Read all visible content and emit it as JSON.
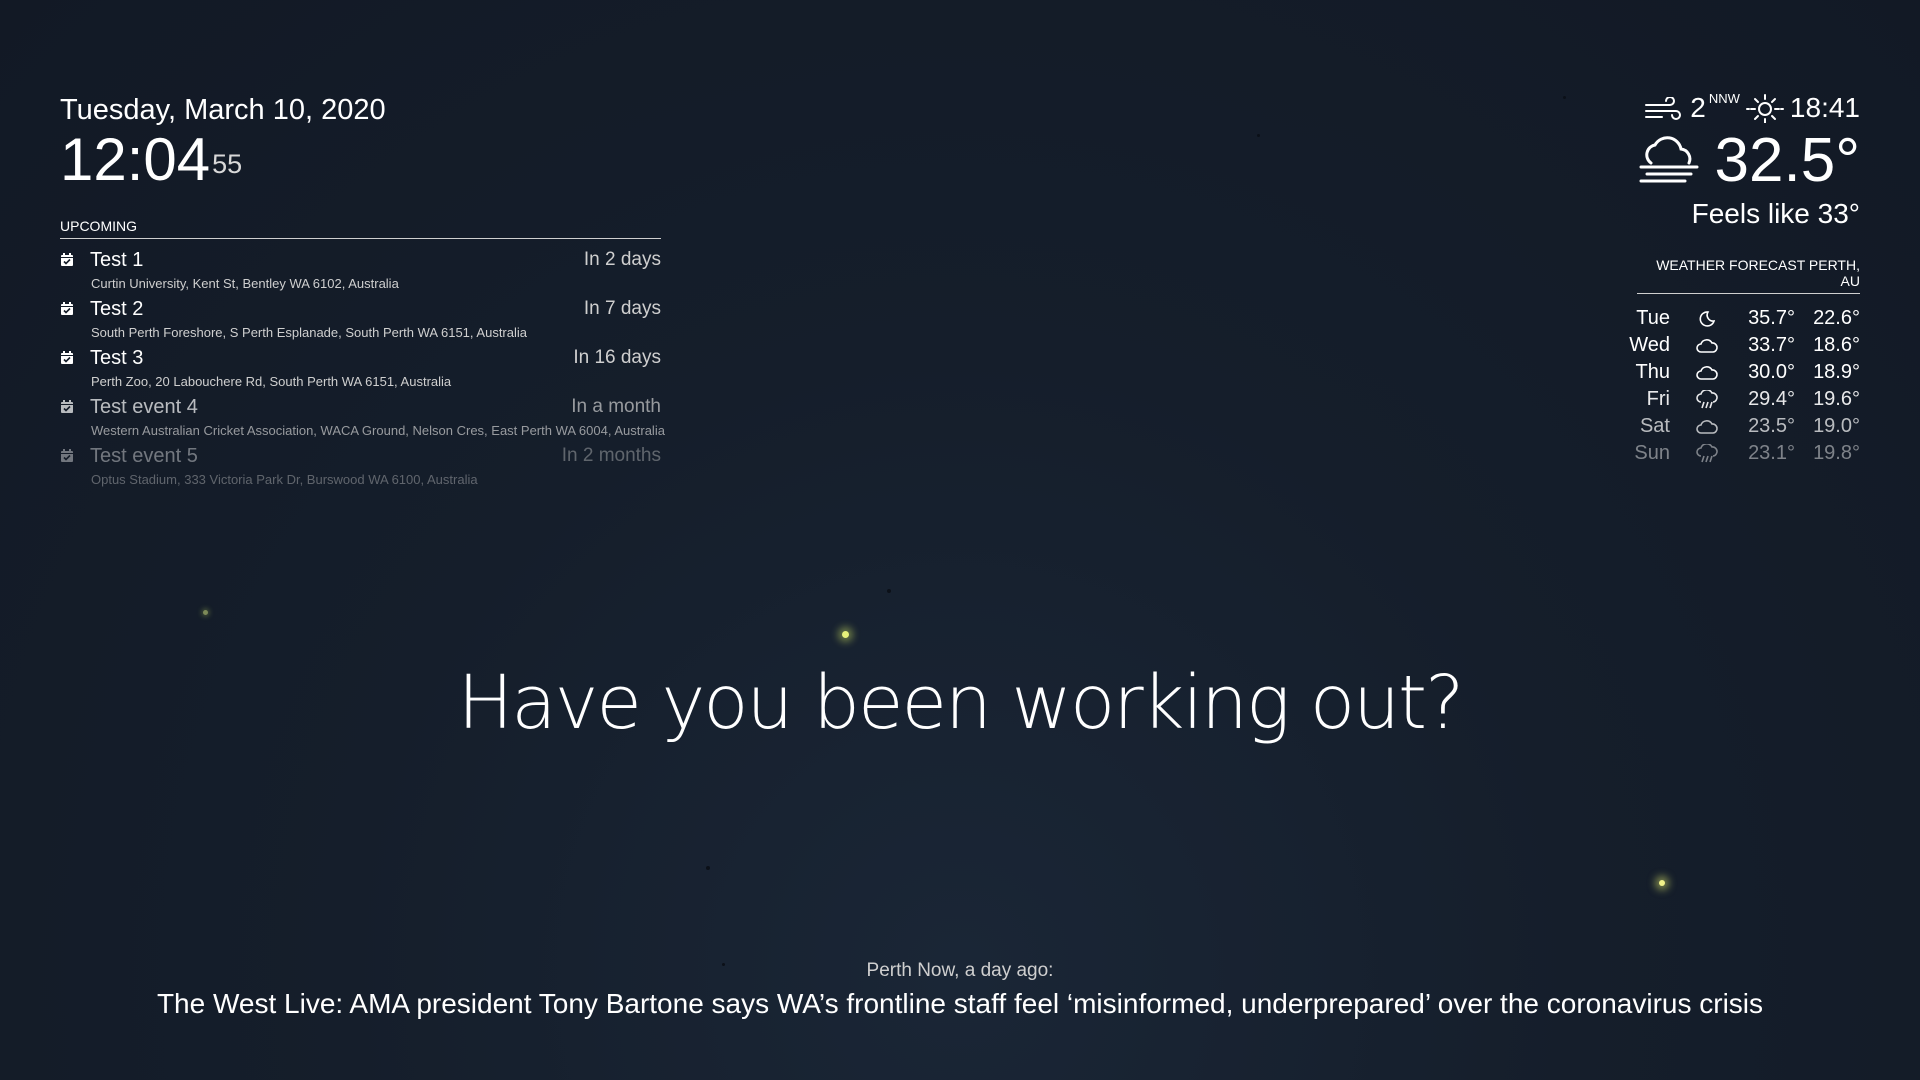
{
  "clock": {
    "date": "Tuesday, March 10, 2020",
    "time": "12:04",
    "seconds": "55"
  },
  "calendar": {
    "header": "UPCOMING",
    "icon": "calendar-check-icon",
    "events": [
      {
        "title": "Test 1",
        "when": "In 2 days",
        "location": "Curtin University, Kent St, Bentley WA 6102, Australia",
        "opacity": 1.0
      },
      {
        "title": "Test 2",
        "when": "In 7 days",
        "location": "South Perth Foreshore, S Perth Esplanade, South Perth WA 6151, Australia",
        "opacity": 1.0
      },
      {
        "title": "Test 3",
        "when": "In 16 days",
        "location": "Perth Zoo, 20 Labouchere Rd, South Perth WA 6151, Australia",
        "opacity": 1.0
      },
      {
        "title": "Test event 4",
        "when": "In a month",
        "location": "Western Australian Cricket Association, WACA Ground, Nelson Cres, East Perth WA 6004, Australia",
        "opacity": 0.7
      },
      {
        "title": "Test event 5",
        "when": "In 2 months",
        "location": "Optus Stadium, 333 Victoria Park Dr, Burswood WA 6100, Australia",
        "opacity": 0.4
      }
    ]
  },
  "weather": {
    "wind_speed": "2",
    "wind_direction": "NNW",
    "wind_icon": "wind-icon",
    "sun_icon": "sunset-icon",
    "sun_time": "18:41",
    "condition_icon": "cloud-fog-icon",
    "temperature": "32.5°",
    "feels_like": "Feels like 33°"
  },
  "forecast": {
    "header": "WEATHER FORECAST PERTH, AU",
    "days": [
      {
        "day": "Tue",
        "icon": "moon-icon",
        "max": "35.7°",
        "min": "22.6°",
        "opacity": 1.0
      },
      {
        "day": "Wed",
        "icon": "cloud-icon",
        "max": "33.7°",
        "min": "18.6°",
        "opacity": 1.0
      },
      {
        "day": "Thu",
        "icon": "cloud-icon",
        "max": "30.0°",
        "min": "18.9°",
        "opacity": 1.0
      },
      {
        "day": "Fri",
        "icon": "rain-cloud-icon",
        "max": "29.4°",
        "min": "19.6°",
        "opacity": 0.9
      },
      {
        "day": "Sat",
        "icon": "cloud-icon",
        "max": "23.5°",
        "min": "19.0°",
        "opacity": 0.7
      },
      {
        "day": "Sun",
        "icon": "rain-cloud-icon",
        "max": "23.1°",
        "min": "19.8°",
        "opacity": 0.45
      }
    ]
  },
  "compliment": {
    "text": "Have you been working out?"
  },
  "news": {
    "source": "Perth Now, a day ago:",
    "title": "The West Live: AMA president Tony Bartone says WA’s frontline staff feel ‘misinformed, underprepared’ over the coronavirus crisis"
  }
}
